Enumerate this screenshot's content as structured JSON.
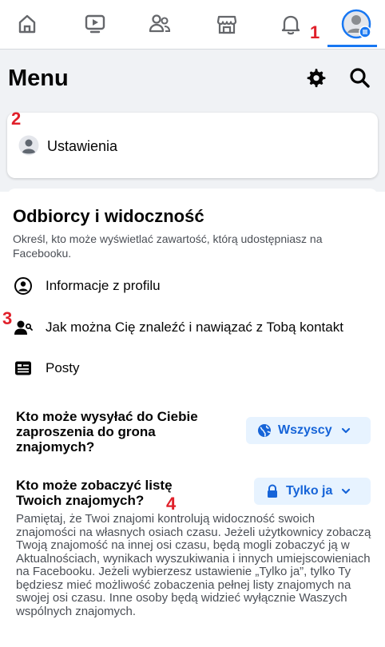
{
  "nav": {
    "icons": [
      "home-icon",
      "video-icon",
      "friends-icon",
      "marketplace-icon",
      "bell-icon",
      "profile-menu-icon"
    ],
    "active": "profile-menu-icon",
    "accent": "#1877f2"
  },
  "annotations": [
    "1",
    "2",
    "3",
    "4"
  ],
  "header": {
    "title": "Menu"
  },
  "settings_card": {
    "label": "Ustawienia"
  },
  "audience": {
    "title": "Odbiorcy i widoczność",
    "description": "Określ, kto może wyświetlać zawartość, którą udostępniasz na Facebooku.",
    "items": [
      {
        "label": "Informacje z profilu",
        "icon": "profile-info-icon"
      },
      {
        "label": "Jak można Cię znaleźć i nawiązać z Tobą kontakt",
        "icon": "find-contact-icon"
      },
      {
        "label": "Posty",
        "icon": "posts-icon"
      }
    ]
  },
  "questions": [
    {
      "label": "Kto może wysyłać do Ciebie zaproszenia do grona znajomych?",
      "value": "Wszyscy",
      "icon": "globe-icon"
    },
    {
      "label": "Kto może zobaczyć listę Twoich znajomych?",
      "value": "Tylko ja",
      "icon": "lock-icon"
    }
  ],
  "note": "Pamiętaj, że Twoi znajomi kontrolują widoczność swoich znajomości na własnych osiach czasu. Jeżeli użytkownicy zobaczą Twoją znajomość na innej osi czasu, będą mogli zobaczyć ją w Aktualnościach, wynikach wyszukiwania i innych umiejscowieniach na Facebooku. Jeżeli wybierzesz ustawienie „Tylko ja”, tylko Ty będziesz mieć możliwość zobaczenia pełnej listy znajomych na swojej osi czasu. Inne osoby będą widzieć wyłącznie Waszych wspólnych znajomych.",
  "colors": {
    "pill_bg": "#e7f3ff",
    "pill_text": "#1664d8",
    "annotation": "#e0202a",
    "page_bg": "#f0f2f5"
  }
}
